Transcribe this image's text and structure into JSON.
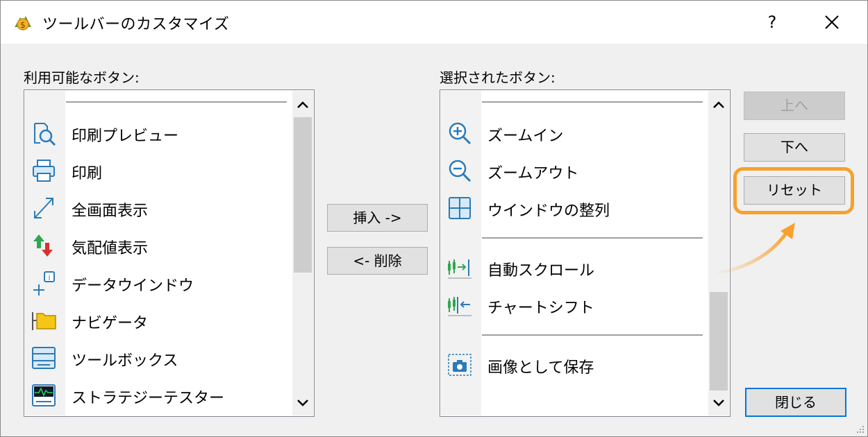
{
  "window": {
    "title": "ツールバーのカスタマイズ",
    "help": "?"
  },
  "available": {
    "label": "利用可能なボタン:",
    "items": [
      {
        "label": "印刷プレビュー",
        "icon": "print-preview-icon"
      },
      {
        "label": "印刷",
        "icon": "printer-icon"
      },
      {
        "label": "全画面表示",
        "icon": "fullscreen-icon"
      },
      {
        "label": "気配値表示",
        "icon": "market-watch-icon"
      },
      {
        "label": "データウインドウ",
        "icon": "data-window-icon"
      },
      {
        "label": "ナビゲータ",
        "icon": "navigator-icon"
      },
      {
        "label": "ツールボックス",
        "icon": "toolbox-icon"
      },
      {
        "label": "ストラテジーテスター",
        "icon": "strategy-tester-icon"
      }
    ]
  },
  "selected": {
    "label": "選択されたボタン:",
    "items": [
      {
        "label": "ズームイン",
        "icon": "zoom-in-icon"
      },
      {
        "label": "ズームアウト",
        "icon": "zoom-out-icon"
      },
      {
        "label": "ウインドウの整列",
        "icon": "tile-windows-icon"
      },
      {
        "label": "自動スクロール",
        "icon": "auto-scroll-icon"
      },
      {
        "label": "チャートシフト",
        "icon": "chart-shift-icon"
      },
      {
        "label": "画像として保存",
        "icon": "save-as-image-icon"
      }
    ]
  },
  "buttons": {
    "insert": "挿入 ->",
    "delete": "<- 削除",
    "up": "上へ",
    "down": "下へ",
    "reset": "リセット",
    "close": "閉じる"
  },
  "colors": {
    "accent": "#0078d7",
    "highlight": "#f7a12c"
  }
}
